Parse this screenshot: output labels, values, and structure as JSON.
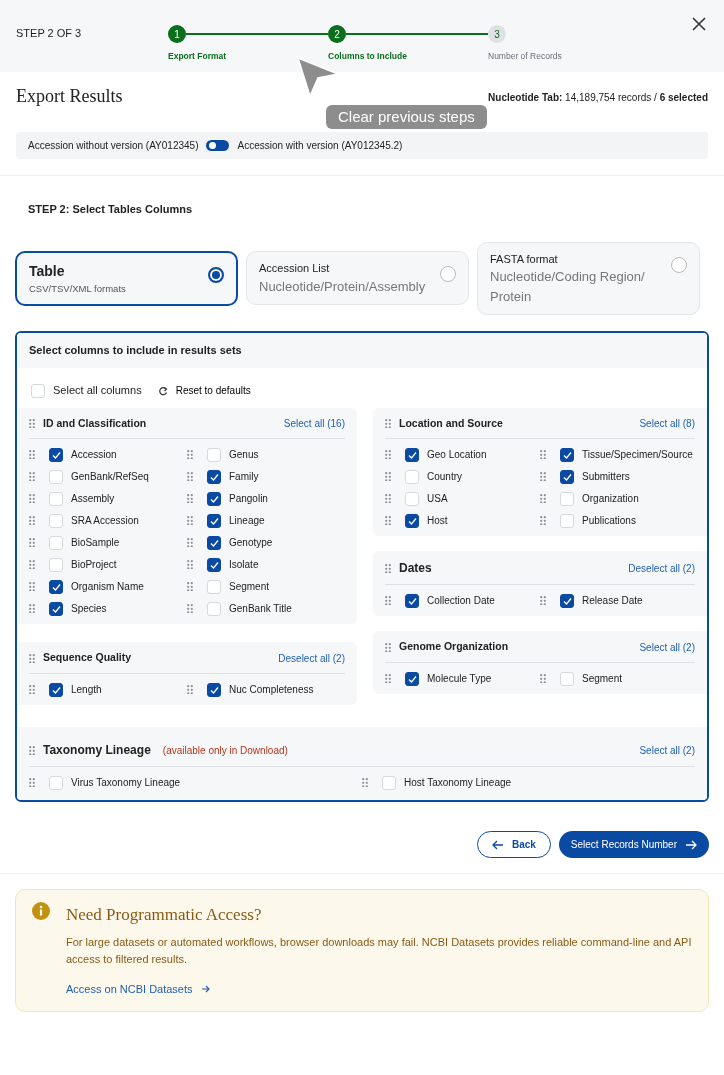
{
  "header": {
    "step_counter": "STEP 2 OF 3",
    "steps": [
      {
        "number": "1",
        "label": "Export Format",
        "reached": true
      },
      {
        "number": "2",
        "label": "Columns to Include",
        "reached": true
      },
      {
        "number": "3",
        "label": "Number of Records",
        "reached": false
      }
    ]
  },
  "tooltip": {
    "text": "Clear previous steps"
  },
  "title": "Export Results",
  "summary": {
    "label": "Nucleotide Tab:",
    "records": "14,189,754 records / ",
    "selected": "6 selected"
  },
  "version_toggle": {
    "off_label": "Accession without version (AY012345)",
    "on_label": "Accession with version (AY012345.2)",
    "on": false
  },
  "step_heading": "STEP 2: Select Tables Columns",
  "formats": [
    {
      "title": "Table",
      "subtitle": "CSV/TSV/XML formats",
      "selected": true
    },
    {
      "title": "Accession List",
      "subtitle": "Nucleotide/Protein/Assembly",
      "selected": false
    },
    {
      "title": "FASTA format",
      "subtitle": "Nucleotide/Coding Region/ Protein",
      "selected": false
    }
  ],
  "columns_panel": {
    "title": "Select columns to include in results sets",
    "select_all": {
      "label": "Select all columns",
      "checked": false
    },
    "reset": "Reset to defaults",
    "left_groups": [
      {
        "title": "ID and Classification",
        "action": "Select all (16)",
        "items": [
          {
            "label": "Accession",
            "checked": true
          },
          {
            "label": "Genus",
            "checked": false
          },
          {
            "label": "GenBank/RefSeq",
            "checked": false
          },
          {
            "label": "Family",
            "checked": true
          },
          {
            "label": "Assembly",
            "checked": false
          },
          {
            "label": "Pangolin",
            "checked": true
          },
          {
            "label": "SRA Accession",
            "checked": false
          },
          {
            "label": "Lineage",
            "checked": true
          },
          {
            "label": "BioSample",
            "checked": false
          },
          {
            "label": "Genotype",
            "checked": true
          },
          {
            "label": "BioProject",
            "checked": false
          },
          {
            "label": "Isolate",
            "checked": true
          },
          {
            "label": "Organism Name",
            "checked": true
          },
          {
            "label": "Segment",
            "checked": false
          },
          {
            "label": "Species",
            "checked": true
          },
          {
            "label": "GenBank Title",
            "checked": false
          }
        ]
      },
      {
        "title": "Sequence Quality",
        "action": "Deselect all (2)",
        "items": [
          {
            "label": "Length",
            "checked": true
          },
          {
            "label": "Nuc Completeness",
            "checked": true
          }
        ]
      }
    ],
    "right_groups": [
      {
        "title": "Location and Source",
        "action": "Select all (8)",
        "items": [
          {
            "label": "Geo Location",
            "checked": true
          },
          {
            "label": "Tissue/Specimen/Source",
            "checked": true
          },
          {
            "label": "Country",
            "checked": false
          },
          {
            "label": "Submitters",
            "checked": true
          },
          {
            "label": "USA",
            "checked": false
          },
          {
            "label": "Organization",
            "checked": false
          },
          {
            "label": "Host",
            "checked": true
          },
          {
            "label": "Publications",
            "checked": false
          }
        ]
      },
      {
        "title": "Dates",
        "action": "Deselect all (2)",
        "items": [
          {
            "label": "Collection Date",
            "checked": true
          },
          {
            "label": "Release Date",
            "checked": true
          }
        ]
      },
      {
        "title": "Genome Organization",
        "action": "Select all (2)",
        "items": [
          {
            "label": "Molecule Type",
            "checked": true
          },
          {
            "label": "Segment",
            "checked": false
          }
        ]
      }
    ],
    "full_groups": [
      {
        "title": "Taxonomy Lineage",
        "note": "(available only in Download)",
        "action": "Select all (2)",
        "items": [
          {
            "label": "Virus Taxonomy Lineage",
            "checked": false
          },
          {
            "label": "Host Taxonomy Lineage",
            "checked": false
          }
        ]
      }
    ]
  },
  "buttons": {
    "back": "Back",
    "next": "Select Records Number"
  },
  "alert": {
    "title": "Need Programmatic Access?",
    "text": "For large datasets or automated workflows, browser downloads may fail. NCBI Datasets provides reliable command-line and API access to filtered results.",
    "link": "Access on NCBI Datasets"
  }
}
